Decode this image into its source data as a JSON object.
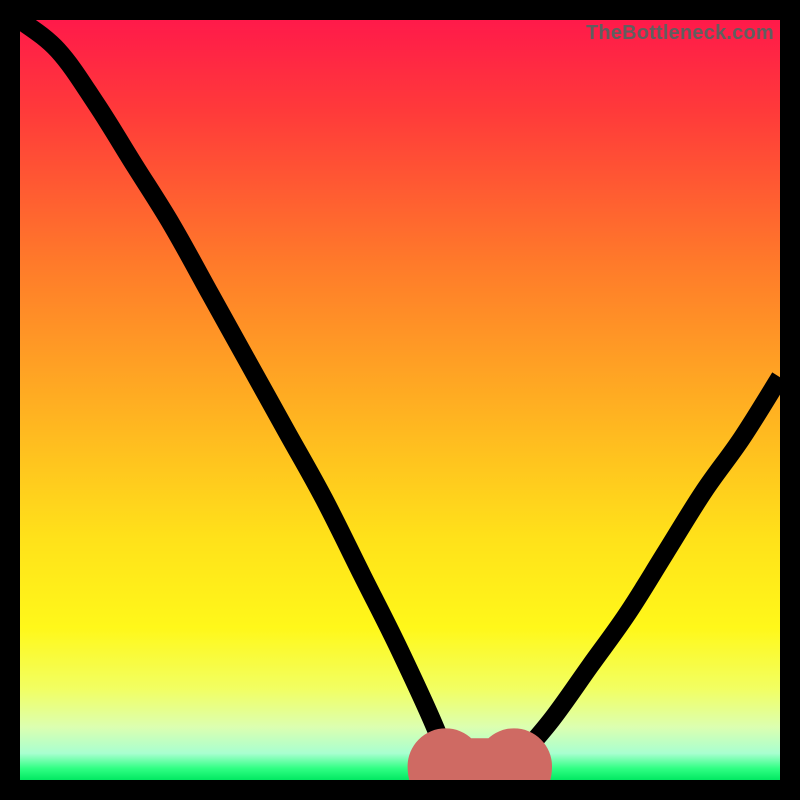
{
  "watermark": "TheBottleneck.com",
  "colors": {
    "black": "#000000",
    "marker": "#cf6a63",
    "gradient_stops": [
      {
        "offset": 0.0,
        "color": "#ff1a4a"
      },
      {
        "offset": 0.12,
        "color": "#ff3a3a"
      },
      {
        "offset": 0.32,
        "color": "#ff7a2a"
      },
      {
        "offset": 0.52,
        "color": "#ffb321"
      },
      {
        "offset": 0.68,
        "color": "#ffe11a"
      },
      {
        "offset": 0.8,
        "color": "#fff81a"
      },
      {
        "offset": 0.88,
        "color": "#f2ff62"
      },
      {
        "offset": 0.93,
        "color": "#dcffb0"
      },
      {
        "offset": 0.965,
        "color": "#a8ffd0"
      },
      {
        "offset": 0.985,
        "color": "#2fff83"
      },
      {
        "offset": 1.0,
        "color": "#02e862"
      }
    ]
  },
  "chart_data": {
    "type": "line",
    "title": "",
    "xlabel": "",
    "ylabel": "",
    "xlim": [
      0,
      100
    ],
    "ylim": [
      0,
      100
    ],
    "grid": false,
    "note": "Axes are implicit (no ticks or labels in image). Values estimated from pixel heights.",
    "series": [
      {
        "name": "bottleneck-curve",
        "x": [
          0,
          5,
          10,
          15,
          20,
          25,
          30,
          35,
          40,
          45,
          50,
          55,
          56,
          60,
          64,
          65,
          70,
          75,
          80,
          85,
          90,
          95,
          100
        ],
        "y": [
          100,
          96,
          89,
          81,
          73,
          64,
          55,
          46,
          37,
          27,
          17,
          6,
          2,
          0,
          0,
          2,
          8,
          15,
          22,
          30,
          38,
          45,
          53
        ]
      }
    ],
    "marker": {
      "name": "highlight-floor",
      "x_range": [
        56,
        65
      ],
      "y": 0.5
    }
  }
}
